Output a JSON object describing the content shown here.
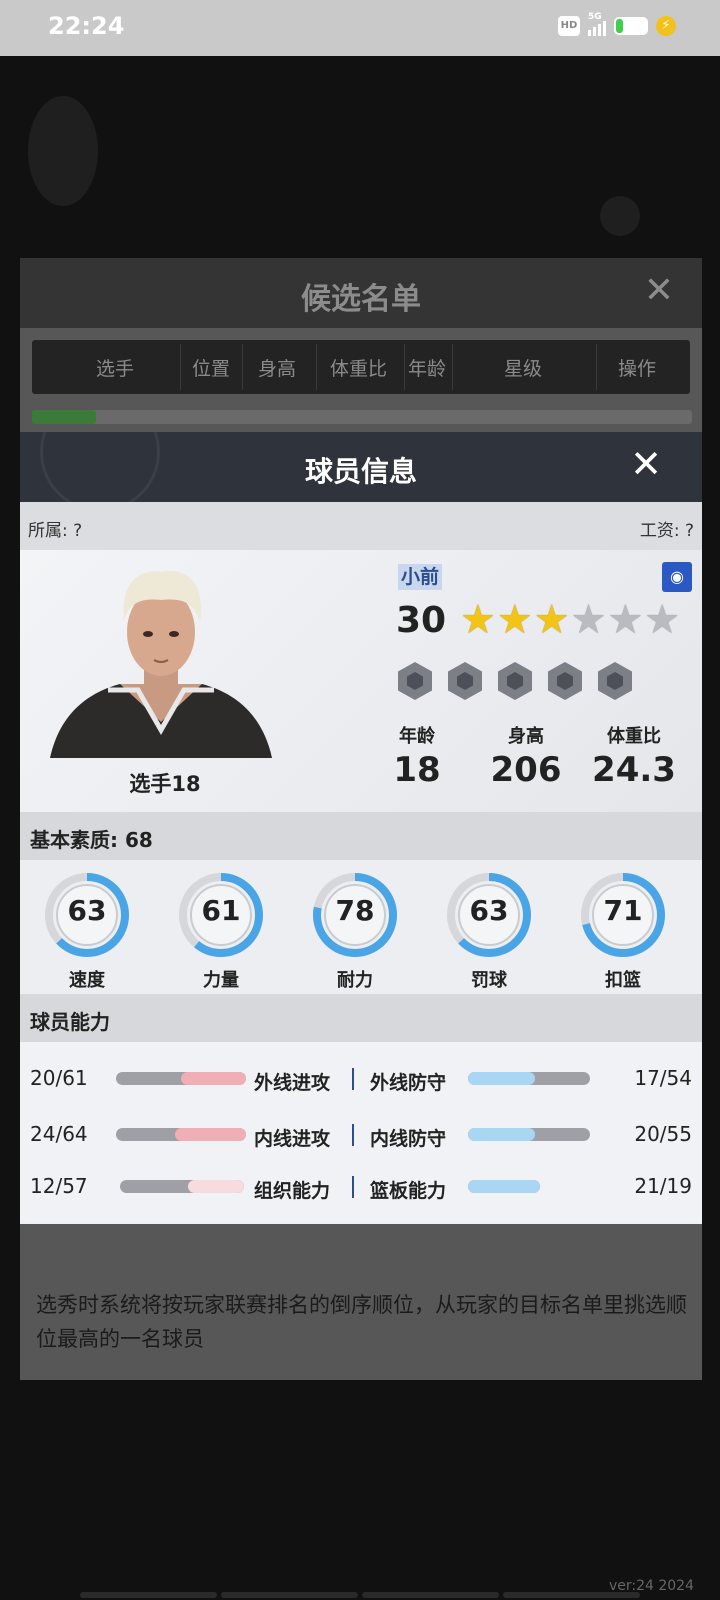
{
  "status_bar": {
    "time": "22:24",
    "hd": "HD",
    "network": "5G",
    "battery_level": 0.2,
    "battery_color": "#3bd24a",
    "charging_color": "#f2c21b"
  },
  "candidate_panel": {
    "title": "候选名单",
    "columns": [
      "选手",
      "位置",
      "身高",
      "体重比",
      "年龄",
      "星级",
      "操作"
    ],
    "note": "选秀时系统将按玩家联赛排名的倒序顺位，从玩家的目标名单里挑选顺位最高的一名球员"
  },
  "player_modal": {
    "title": "球员信息",
    "affiliation": "所属: ?",
    "salary": "工资: ?",
    "player_name": "选手18",
    "position": "小前",
    "overall": "30",
    "stars_filled": 3,
    "stars_total": 6,
    "badge_count": 5,
    "attributes": [
      {
        "label": "年龄",
        "value": "18"
      },
      {
        "label": "身高",
        "value": "206"
      },
      {
        "label": "体重比",
        "value": "24.3"
      }
    ],
    "basic_quality": "基本素质: 68",
    "gauges": [
      {
        "label": "速度",
        "value": "63"
      },
      {
        "label": "力量",
        "value": "61"
      },
      {
        "label": "耐力",
        "value": "78"
      },
      {
        "label": "罚球",
        "value": "63"
      },
      {
        "label": "扣篮",
        "value": "71"
      }
    ],
    "ability_title": "球员能力",
    "abilities": [
      {
        "left_label": "外线进攻",
        "left_value": "20/61",
        "left_ratio": 0.5,
        "right_label": "外线防守",
        "right_value": "17/54",
        "right_ratio": 0.55
      },
      {
        "left_label": "内线进攻",
        "left_value": "24/64",
        "left_ratio": 0.55,
        "right_label": "内线防守",
        "right_value": "20/55",
        "right_ratio": 0.55
      },
      {
        "left_label": "组织能力",
        "left_value": "12/57",
        "left_ratio": 0.45,
        "right_label": "篮板能力",
        "right_value": "21/19",
        "right_ratio": 1.0
      }
    ],
    "accent_color": "#4aa5e6"
  },
  "footer": {
    "version": "ver:24  2024"
  }
}
